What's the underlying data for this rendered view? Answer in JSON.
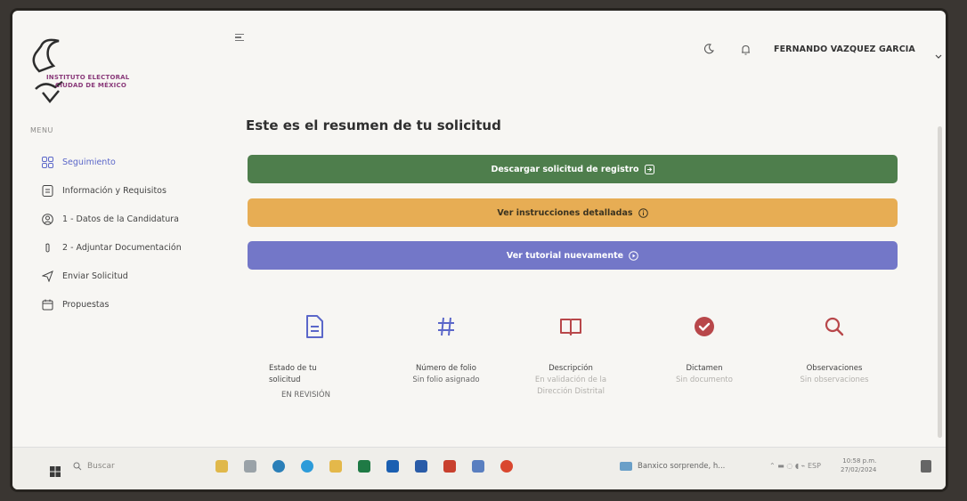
{
  "browser": {
    "top_hint": ""
  },
  "logo": {
    "line1": "INSTITUTO ELECTORAL",
    "line2": "CIUDAD DE MÉXICO"
  },
  "sidebar": {
    "menu_caption": "MENU",
    "items": [
      {
        "label": "Seguimiento",
        "icon": "grid-icon",
        "active": true
      },
      {
        "label": "Información y Requisitos",
        "icon": "document-icon",
        "active": false
      },
      {
        "label": "1 - Datos de la Candidatura",
        "icon": "user-circle-icon",
        "active": false
      },
      {
        "label": "2 - Adjuntar Documentación",
        "icon": "paperclip-icon",
        "active": false
      },
      {
        "label": "Enviar Solicitud",
        "icon": "send-icon",
        "active": false
      },
      {
        "label": "Propuestas",
        "icon": "calendar-icon",
        "active": false
      }
    ]
  },
  "header": {
    "user_name": "FERNANDO VAZQUEZ GARCIA"
  },
  "main": {
    "title": "Este es el resumen de tu solicitud",
    "buttons": {
      "download": "Descargar solicitud de registro",
      "instructions": "Ver instrucciones detalladas",
      "tutorial": "Ver tutorial nuevamente"
    },
    "cards": [
      {
        "label_1": "Estado de tu",
        "label_2": "solicitud",
        "value": "EN REVISIÓN"
      },
      {
        "label": "Número de folio",
        "value": "Sin folio asignado"
      },
      {
        "label": "Descripción",
        "value_1": "En validación de la",
        "value_2": "Dirección Distrital"
      },
      {
        "label": "Dictamen",
        "value": "Sin documento"
      },
      {
        "label": "Observaciones",
        "value": "Sin observaciones"
      }
    ]
  },
  "taskbar": {
    "search_placeholder": "Buscar",
    "news": "Banxico sorprende, h...",
    "tray": "ESP",
    "clock_time": "10:58 p.m.",
    "clock_date": "27/02/2024"
  },
  "colors": {
    "green": "#4e7e4c",
    "orange": "#e7ad54",
    "purple": "#7377c8",
    "accent": "#5b67c9",
    "danger": "#b8474a"
  }
}
